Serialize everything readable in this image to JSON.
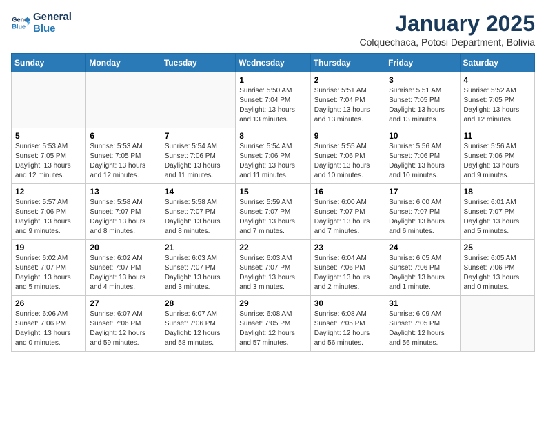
{
  "header": {
    "logo_general": "General",
    "logo_blue": "Blue",
    "month_title": "January 2025",
    "subtitle": "Colquechaca, Potosi Department, Bolivia"
  },
  "days_of_week": [
    "Sunday",
    "Monday",
    "Tuesday",
    "Wednesday",
    "Thursday",
    "Friday",
    "Saturday"
  ],
  "weeks": [
    {
      "days": [
        {
          "num": "",
          "info": ""
        },
        {
          "num": "",
          "info": ""
        },
        {
          "num": "",
          "info": ""
        },
        {
          "num": "1",
          "info": "Sunrise: 5:50 AM\nSunset: 7:04 PM\nDaylight: 13 hours and 13 minutes."
        },
        {
          "num": "2",
          "info": "Sunrise: 5:51 AM\nSunset: 7:04 PM\nDaylight: 13 hours and 13 minutes."
        },
        {
          "num": "3",
          "info": "Sunrise: 5:51 AM\nSunset: 7:05 PM\nDaylight: 13 hours and 13 minutes."
        },
        {
          "num": "4",
          "info": "Sunrise: 5:52 AM\nSunset: 7:05 PM\nDaylight: 13 hours and 12 minutes."
        }
      ]
    },
    {
      "days": [
        {
          "num": "5",
          "info": "Sunrise: 5:53 AM\nSunset: 7:05 PM\nDaylight: 13 hours and 12 minutes."
        },
        {
          "num": "6",
          "info": "Sunrise: 5:53 AM\nSunset: 7:05 PM\nDaylight: 13 hours and 12 minutes."
        },
        {
          "num": "7",
          "info": "Sunrise: 5:54 AM\nSunset: 7:06 PM\nDaylight: 13 hours and 11 minutes."
        },
        {
          "num": "8",
          "info": "Sunrise: 5:54 AM\nSunset: 7:06 PM\nDaylight: 13 hours and 11 minutes."
        },
        {
          "num": "9",
          "info": "Sunrise: 5:55 AM\nSunset: 7:06 PM\nDaylight: 13 hours and 10 minutes."
        },
        {
          "num": "10",
          "info": "Sunrise: 5:56 AM\nSunset: 7:06 PM\nDaylight: 13 hours and 10 minutes."
        },
        {
          "num": "11",
          "info": "Sunrise: 5:56 AM\nSunset: 7:06 PM\nDaylight: 13 hours and 9 minutes."
        }
      ]
    },
    {
      "days": [
        {
          "num": "12",
          "info": "Sunrise: 5:57 AM\nSunset: 7:06 PM\nDaylight: 13 hours and 9 minutes."
        },
        {
          "num": "13",
          "info": "Sunrise: 5:58 AM\nSunset: 7:07 PM\nDaylight: 13 hours and 8 minutes."
        },
        {
          "num": "14",
          "info": "Sunrise: 5:58 AM\nSunset: 7:07 PM\nDaylight: 13 hours and 8 minutes."
        },
        {
          "num": "15",
          "info": "Sunrise: 5:59 AM\nSunset: 7:07 PM\nDaylight: 13 hours and 7 minutes."
        },
        {
          "num": "16",
          "info": "Sunrise: 6:00 AM\nSunset: 7:07 PM\nDaylight: 13 hours and 7 minutes."
        },
        {
          "num": "17",
          "info": "Sunrise: 6:00 AM\nSunset: 7:07 PM\nDaylight: 13 hours and 6 minutes."
        },
        {
          "num": "18",
          "info": "Sunrise: 6:01 AM\nSunset: 7:07 PM\nDaylight: 13 hours and 5 minutes."
        }
      ]
    },
    {
      "days": [
        {
          "num": "19",
          "info": "Sunrise: 6:02 AM\nSunset: 7:07 PM\nDaylight: 13 hours and 5 minutes."
        },
        {
          "num": "20",
          "info": "Sunrise: 6:02 AM\nSunset: 7:07 PM\nDaylight: 13 hours and 4 minutes."
        },
        {
          "num": "21",
          "info": "Sunrise: 6:03 AM\nSunset: 7:07 PM\nDaylight: 13 hours and 3 minutes."
        },
        {
          "num": "22",
          "info": "Sunrise: 6:03 AM\nSunset: 7:07 PM\nDaylight: 13 hours and 3 minutes."
        },
        {
          "num": "23",
          "info": "Sunrise: 6:04 AM\nSunset: 7:06 PM\nDaylight: 13 hours and 2 minutes."
        },
        {
          "num": "24",
          "info": "Sunrise: 6:05 AM\nSunset: 7:06 PM\nDaylight: 13 hours and 1 minute."
        },
        {
          "num": "25",
          "info": "Sunrise: 6:05 AM\nSunset: 7:06 PM\nDaylight: 13 hours and 0 minutes."
        }
      ]
    },
    {
      "days": [
        {
          "num": "26",
          "info": "Sunrise: 6:06 AM\nSunset: 7:06 PM\nDaylight: 13 hours and 0 minutes."
        },
        {
          "num": "27",
          "info": "Sunrise: 6:07 AM\nSunset: 7:06 PM\nDaylight: 12 hours and 59 minutes."
        },
        {
          "num": "28",
          "info": "Sunrise: 6:07 AM\nSunset: 7:06 PM\nDaylight: 12 hours and 58 minutes."
        },
        {
          "num": "29",
          "info": "Sunrise: 6:08 AM\nSunset: 7:05 PM\nDaylight: 12 hours and 57 minutes."
        },
        {
          "num": "30",
          "info": "Sunrise: 6:08 AM\nSunset: 7:05 PM\nDaylight: 12 hours and 56 minutes."
        },
        {
          "num": "31",
          "info": "Sunrise: 6:09 AM\nSunset: 7:05 PM\nDaylight: 12 hours and 56 minutes."
        },
        {
          "num": "",
          "info": ""
        }
      ]
    }
  ]
}
